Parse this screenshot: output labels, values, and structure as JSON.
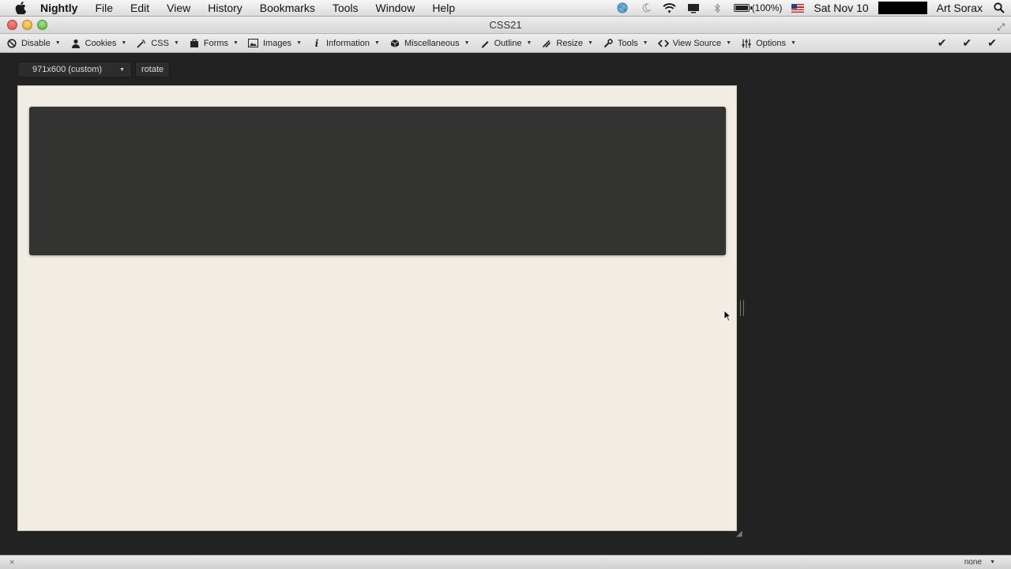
{
  "menubar": {
    "apple_icon": "apple-icon",
    "app_name": "Nightly",
    "items": [
      "File",
      "Edit",
      "View",
      "History",
      "Bookmarks",
      "Tools",
      "Window",
      "Help"
    ],
    "battery_text": "(100%)",
    "clock": "Sat Nov 10",
    "user": "Art Sorax"
  },
  "window": {
    "title": "CSS21"
  },
  "devbar": {
    "items": [
      {
        "label": "Disable",
        "icon": "disable-icon"
      },
      {
        "label": "Cookies",
        "icon": "cookies-icon"
      },
      {
        "label": "CSS",
        "icon": "css-icon"
      },
      {
        "label": "Forms",
        "icon": "forms-icon"
      },
      {
        "label": "Images",
        "icon": "images-icon"
      },
      {
        "label": "Information",
        "icon": "information-icon"
      },
      {
        "label": "Miscellaneous",
        "icon": "miscellaneous-icon"
      },
      {
        "label": "Outline",
        "icon": "outline-icon"
      },
      {
        "label": "Resize",
        "icon": "resize-icon"
      },
      {
        "label": "Tools",
        "icon": "tools-icon"
      },
      {
        "label": "View Source",
        "icon": "view-source-icon"
      },
      {
        "label": "Options",
        "icon": "options-icon"
      }
    ]
  },
  "resize": {
    "size_value": "971x600 (custom)",
    "rotate_label": "rotate"
  },
  "statusbar": {
    "close_glyph": "×",
    "select_value": "none"
  },
  "colors": {
    "background": "#222222",
    "viewport": "#f1ede4",
    "panel": "#333432"
  }
}
